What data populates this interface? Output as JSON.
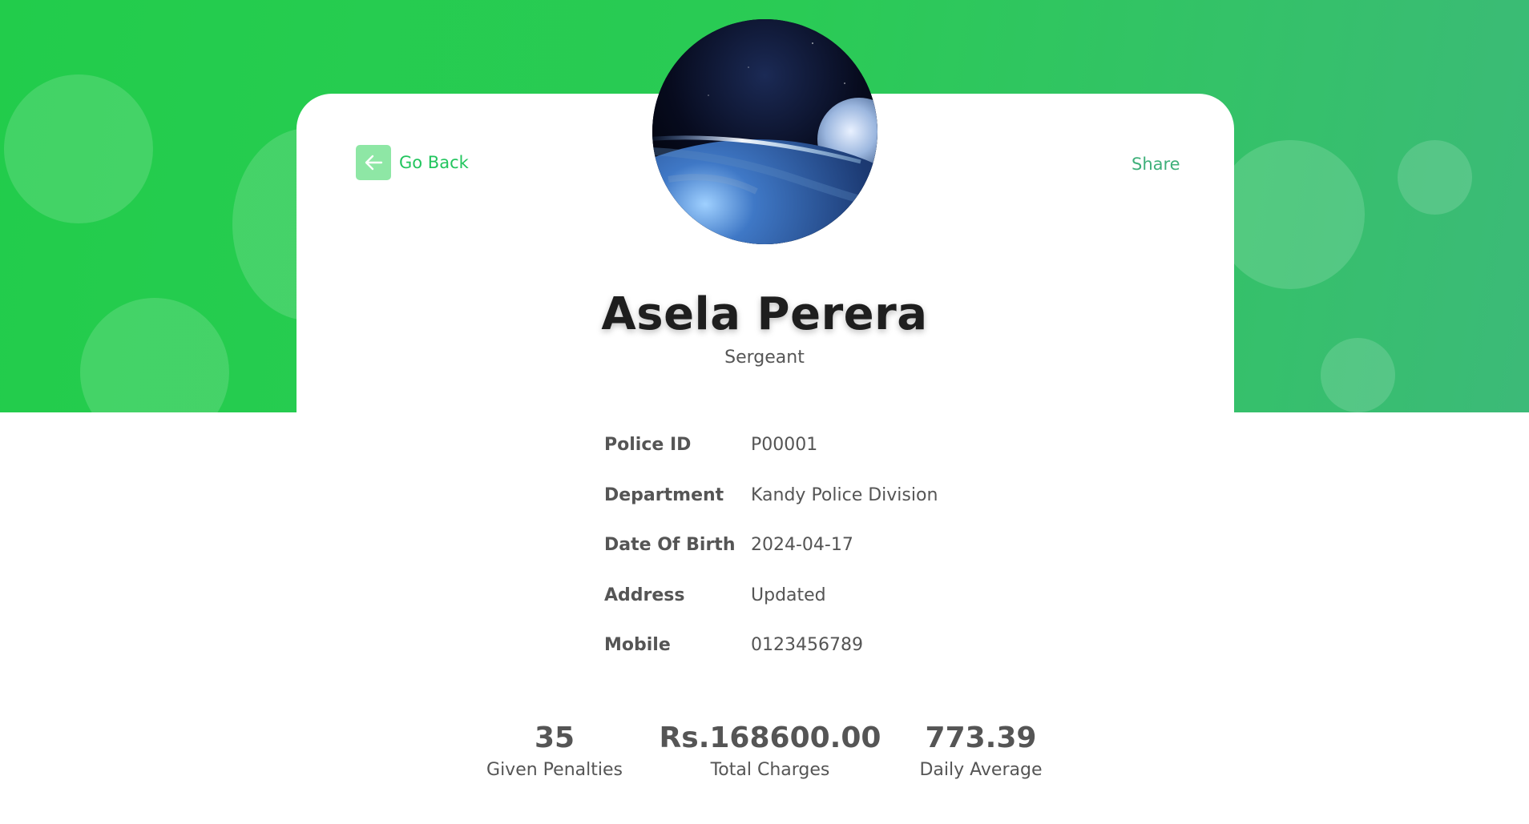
{
  "nav": {
    "back_label": "Go Back",
    "share_label": "Share"
  },
  "profile": {
    "name": "Asela Perera",
    "rank": "Sergeant",
    "avatar_icon": "earth-from-space-image"
  },
  "details": [
    {
      "label": "Police ID",
      "value": "P00001"
    },
    {
      "label": "Department",
      "value": "Kandy Police Division"
    },
    {
      "label": "Date Of Birth",
      "value": "2024-04-17"
    },
    {
      "label": "Address",
      "value": "Updated"
    },
    {
      "label": "Mobile",
      "value": "0123456789"
    }
  ],
  "stats": [
    {
      "value": "35",
      "label": "Given Penalties"
    },
    {
      "value": "Rs.168600.00",
      "label": "Total Charges"
    },
    {
      "value": "773.39",
      "label": "Daily Average"
    }
  ],
  "colors": {
    "brand_green": "#22c55e",
    "hero_start": "#22cc4b",
    "hero_end": "#3cba78",
    "text": "#555555",
    "name_text": "#1e1e1e"
  }
}
